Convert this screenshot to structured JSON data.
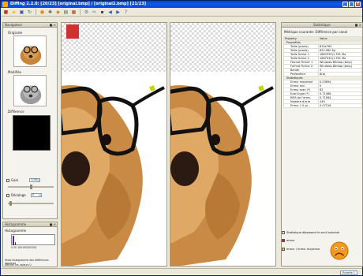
{
  "window": {
    "title": "Diffing 2.2.0: [20/23] [original.bmp] / [original2.bmp] [21/23]"
  },
  "toolbar": {
    "icons": [
      "open-icon",
      "folder-icon",
      "save-icon",
      "refresh-icon",
      "diff-icon",
      "settings-icon",
      "filter-icon",
      "image-icon",
      "overlay-icon",
      "mask-icon",
      "next-icon",
      "prev-icon",
      "back-icon",
      "forward-icon",
      "help-icon"
    ]
  },
  "navigator": {
    "title": "Navigateur",
    "original_label": "Originale",
    "modified_label": "Modifiée",
    "difference_label": "Différence",
    "gain_label": "Gain",
    "gain_value": "1,00",
    "offset_label": "Décalage",
    "offset_value": "0"
  },
  "histogram": {
    "title": "Histogramme",
    "inner_label": "Histogramme",
    "ticks": "0 50 100150200250",
    "caption": "Histo histogramme des différences absolues",
    "show_values_label": "Afficher les valeurs 0"
  },
  "statistics": {
    "title": "Statistique",
    "metric_label": "Métrique courante: Différence par canal",
    "headers": [
      "Property",
      "Value"
    ],
    "groups": [
      {
        "name": "Propriétés",
        "rows": [
          [
            "Taille (pixels)",
            "810x760"
          ],
          [
            "Taille (pixels)",
            "622.080 Kp"
          ],
          [
            "Taille fichier 1",
            "1867930(1.781 Mo"
          ],
          [
            "Taille fichier 2",
            "1867930(1.781 Mo"
          ],
          [
            "Format Fichier 1",
            "Windows Bitmap (bmp)"
          ],
          [
            "Format Fichier 2",
            "Windows Bitmap (bmp)"
          ],
          [
            "Bande",
            "3"
          ],
          [
            "Profondeur",
            "8(b)"
          ]
        ]
      },
      {
        "name": "Statistiques",
        "rows": [
          [
            "Erreur moyenne",
            "0.03694"
          ],
          [
            "Erreur min",
            "0"
          ],
          [
            "Erreur max (*)",
            "82"
          ],
          [
            "Ecart-type (*)",
            "0.71468"
          ],
          [
            "RMS de l'erreu",
            "0.71564"
          ],
          [
            "Nombre d'erre",
            "449"
          ],
          [
            "Erreur ( % pi...",
            "0.07216"
          ]
        ]
      }
    ],
    "threshold_label": "Statistique dépassant le seuil autorisé",
    "legend_error": "erreur",
    "legend_avg": "erreur / erreur moyenne",
    "colors": {
      "error": "#e81010",
      "avg": "#f0e000"
    }
  },
  "status": {
    "zoom": "Echelle 1"
  }
}
